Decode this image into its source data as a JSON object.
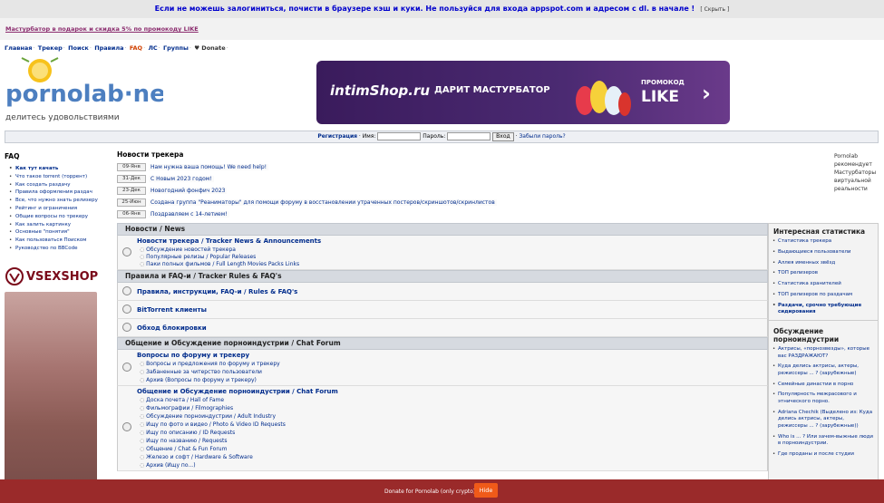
{
  "warning": {
    "text": "Если не можешь залогиниться, почисти в браузере кэш и куки. Не пользуйся для входа appspot.com и адресом с dl. в начале !",
    "hide": "[ Скрыть ]"
  },
  "promo": "Мастурбатор в подарок и скидка 5% по промокоду LIKE",
  "nav": {
    "home": "Главная",
    "tracker": "Трекер",
    "search": "Поиск",
    "rules": "Правила",
    "faq": "FAQ",
    "pm": "ЛС",
    "groups": "Группы",
    "donate": "Donate"
  },
  "logo": {
    "name": "pornolab·net",
    "tagline": "делитесь удовольствиями"
  },
  "banner": {
    "shop": "intimShop.ru",
    "gift": "ДАРИТ МАСТУРБАТОР",
    "promocode_label": "ПРОМОКОД",
    "promocode": "LIKE"
  },
  "login": {
    "register": "Регистрация",
    "name_label": "Имя:",
    "password_label": "Пароль:",
    "submit": "Вход",
    "forgot": "Забыли пароль?"
  },
  "faq": {
    "title": "FAQ",
    "items": [
      {
        "label": "Как тут качать",
        "bold": true
      },
      {
        "label": "Что такое torrent (торрент)"
      },
      {
        "label": "Как создать раздачу"
      },
      {
        "label": "Правила оформления раздач"
      },
      {
        "label": "Все, что нужно знать релизеру"
      },
      {
        "label": "Рейтинг и ограничения"
      },
      {
        "label": "Общие вопросы по трекеру"
      },
      {
        "label": "Как залить картинку"
      },
      {
        "label": "Основные \"понятия\""
      },
      {
        "label": "Как пользоваться Поиском"
      },
      {
        "label": "Руководство по BBCode"
      }
    ]
  },
  "vsex": "VSEXSHOP",
  "tracker_news": {
    "title": "Новости трекера",
    "items": [
      {
        "date": "09-Янв",
        "text": "Нам нужна ваша помощь! We need help!"
      },
      {
        "date": "31-Дек",
        "text": "С Новым 2023 годом!"
      },
      {
        "date": "23-Дек",
        "text": "Новогодний фонфич 2023"
      },
      {
        "date": "25-Июн",
        "text": "Создана группа \"Реаниматоры\" для помощи форуму в восстановлении утраченных постеров/скриншотов/скринлистов"
      },
      {
        "date": "06-Янв",
        "text": "Поздравляем с 14-летием!"
      }
    ]
  },
  "right_note": "Pornolab рекомендует Мастурбаторы виртуальной реальности",
  "categories": [
    {
      "title": "Новости / News",
      "forums": [
        {
          "title": "Новости трекера / Tracker News & Announcements",
          "subs": [
            "Обсуждение новостей трекера",
            "Популярные релизы / Popular Releases",
            "Паки полных фильмов / Full Length Movies Packs Links"
          ]
        }
      ]
    },
    {
      "title": "Правила и FAQ-и / Tracker Rules & FAQ's",
      "forums": [
        {
          "title": "Правила, инструкции, FAQ-и / Rules & FAQ's",
          "subs": []
        },
        {
          "title": "BitTorrent клиенты",
          "subs": []
        },
        {
          "title": "Обход блокировки",
          "subs": []
        }
      ]
    },
    {
      "title": "Общение и Обсуждение порноиндустрии / Chat Forum",
      "forums": [
        {
          "title": "Вопросы по форуму и трекеру",
          "subs": [
            "Вопросы и предложения по форуму и трекеру",
            "Забаненные за читерство пользователи",
            "Архив (Вопросы по форуму и трекеру)"
          ]
        },
        {
          "title": "Общение и Обсуждение порноиндустрии / Chat Forum",
          "subs": [
            "Доска почета / Hall of Fame",
            "Фильмографии / Filmographies",
            "Обсуждение порноиндустрии / Adult Industry",
            "Ищу по фото и видео / Photo & Video ID Requests",
            "Ищу по описанию / ID Requests",
            "Ищу по названию / Requests",
            "Общение / Chat & Fun Forum",
            "Железо и софт / Hardware & Software",
            "Архив (Ищу по...)"
          ]
        }
      ]
    }
  ],
  "stats": {
    "title": "Интересная статистика",
    "items": [
      {
        "label": "Статистика трекера"
      },
      {
        "label": "Выдающиеся пользователи"
      },
      {
        "label": "Аллея именных звёзд"
      },
      {
        "label": "ТОП релизеров"
      },
      {
        "label": "Статистика хранителей"
      },
      {
        "label": "ТОП релизеров по раздачам"
      },
      {
        "label": "Раздачи, срочно требующие сидирования",
        "bold": true
      }
    ]
  },
  "discussion": {
    "title": "Обсуждение порноиндустрии",
    "items": [
      {
        "label": "Актрисы, «порнозвезды», которые вас РАЗДРАЖАЮТ?"
      },
      {
        "label": "Куда делись актрисы, актеры, режиссеры ... ? (зарубежные)"
      },
      {
        "label": "Семейные династии в порно"
      },
      {
        "label": "Популярность межрасового и этнического порно."
      },
      {
        "label": "Adriana Chechik (Выделено из: Куда делись актрисы, актеры, режиссеры ... ? (зарубежные))"
      },
      {
        "label": "Who is ... ? Или зачем-выжные люди в порноиндустрии."
      },
      {
        "label": "Где проданы и после студии"
      }
    ]
  },
  "footer": {
    "text": "Donate for Pornolab (only crypto)",
    "hide": "Hide"
  },
  "colors": {
    "link": "#002c8c",
    "footer": "#9a2a2a",
    "hide_button": "#f05a19",
    "category": "#d6dae0"
  }
}
